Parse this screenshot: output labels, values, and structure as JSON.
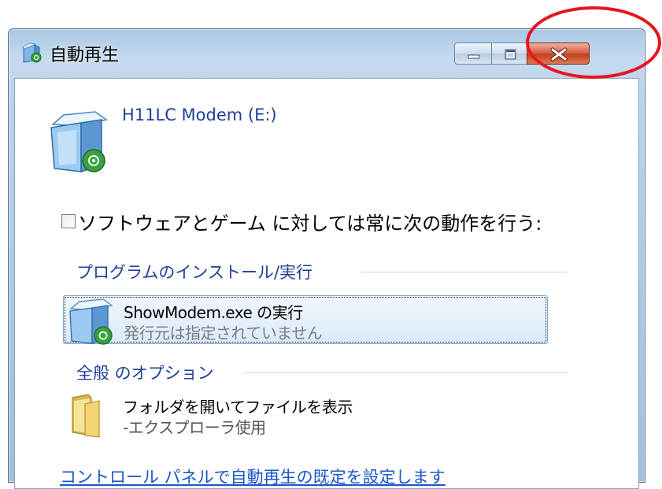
{
  "window": {
    "title": "自動再生",
    "icons": {
      "app": "autoplay-icon",
      "minimize": "minimize-icon",
      "maximize": "maximize-icon",
      "close": "close-icon"
    },
    "accent_color": "#1f3f9a",
    "close_color": "#c5401f"
  },
  "device": {
    "name": "H11LC Modem (E:)",
    "icon": "modem-device-icon"
  },
  "always_option": {
    "checked": false,
    "label": "ソフトウェアとゲーム に対しては常に次の動作を行う:"
  },
  "groups": {
    "install": {
      "label": "プログラムのインストール/実行",
      "item": {
        "title": "ShowModem.exe の実行",
        "subtitle": "発行元は指定されていません",
        "icon": "modem-program-icon"
      }
    },
    "general": {
      "label": "全般 のオプション",
      "item": {
        "title": "フォルダを開いてファイルを表示",
        "subtitle": "-エクスプローラ使用",
        "icon": "folder-icon"
      }
    }
  },
  "footer": {
    "link": "コントロール パネルで自動再生の既定を設定します"
  },
  "annotation": {
    "color": "#e8141e",
    "target": "close-button"
  }
}
